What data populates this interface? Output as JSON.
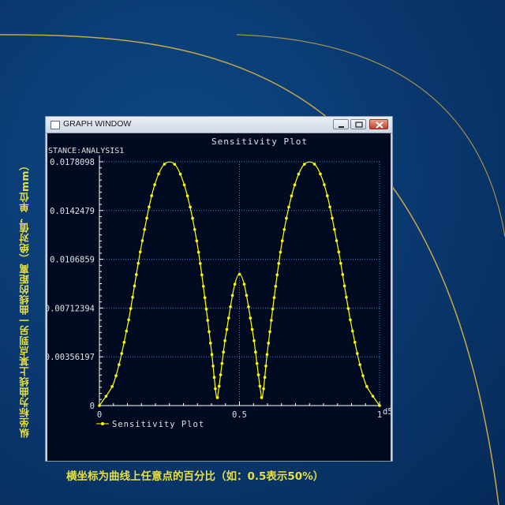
{
  "captions": {
    "vertical": "纵坐标为曲线上某点到另一曲线的距离（绝对值，单位mm）",
    "bottom": "横坐标为曲线上任意点的百分比（如：0.5表示50%）"
  },
  "window": {
    "title": "GRAPH WINDOW",
    "buttons": [
      "minimize-icon",
      "maximize-icon",
      "close-icon"
    ]
  },
  "chart_data": {
    "type": "line",
    "title": "Sensitivity Plot",
    "ylabel": "STANCE:ANALYSIS1",
    "x_tick_labels": [
      "0",
      "0.5",
      "1"
    ],
    "x_end_label": "d5",
    "y_tick_labels": [
      "0",
      "0.00356197",
      "0.00712394",
      "0.0106859",
      "0.0142479",
      "0.0178098"
    ],
    "xlim": [
      0,
      1
    ],
    "ylim": [
      0,
      0.0178098
    ],
    "grid": true,
    "legend_position": "bottom-left",
    "series": [
      {
        "name": "Sensitivity Plot",
        "color": "#ffff00",
        "x": [
          0,
          0.05,
          0.1,
          0.15,
          0.2,
          0.25,
          0.3,
          0.35,
          0.4,
          0.42,
          0.45,
          0.5,
          0.55,
          0.58,
          0.6,
          0.65,
          0.7,
          0.75,
          0.8,
          0.85,
          0.9,
          0.95,
          1.0
        ],
        "y": [
          0,
          0.0016,
          0.0058,
          0.0117,
          0.0163,
          0.0178,
          0.0163,
          0.0117,
          0.004,
          0.0005,
          0.005,
          0.0096,
          0.005,
          0.0005,
          0.004,
          0.0117,
          0.0163,
          0.0178,
          0.0163,
          0.0117,
          0.0058,
          0.0016,
          0
        ]
      }
    ]
  }
}
